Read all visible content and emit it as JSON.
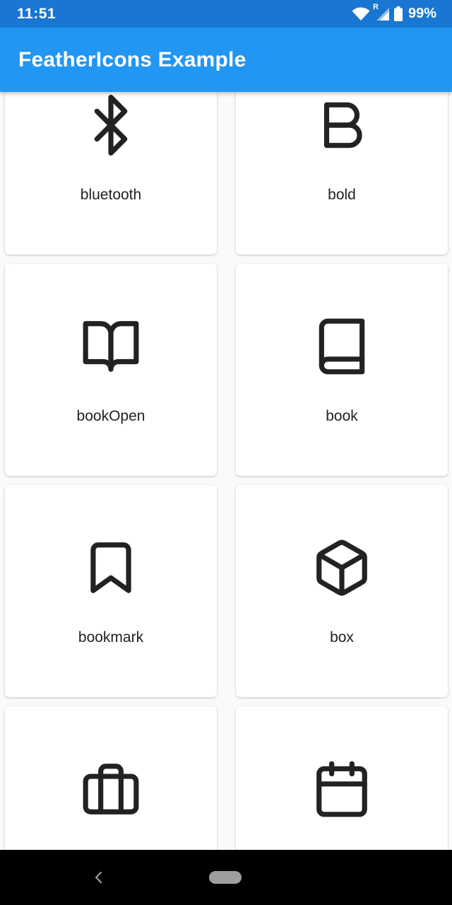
{
  "status_bar": {
    "time": "11:51",
    "network_badge": "R",
    "battery_percent": "99%",
    "icons": [
      "wifi-icon",
      "cell-signal-icon",
      "battery-icon"
    ]
  },
  "app_bar": {
    "title": "FeatherIcons Example",
    "color": "#2196f3",
    "status_color": "#1976d2"
  },
  "grid": {
    "items": [
      {
        "label": "bluetooth",
        "icon": "bluetooth-icon"
      },
      {
        "label": "bold",
        "icon": "bold-icon"
      },
      {
        "label": "bookOpen",
        "icon": "book-open-icon"
      },
      {
        "label": "book",
        "icon": "book-icon"
      },
      {
        "label": "bookmark",
        "icon": "bookmark-icon"
      },
      {
        "label": "box",
        "icon": "box-icon"
      },
      {
        "label": "",
        "icon": "briefcase-icon"
      },
      {
        "label": "",
        "icon": "calendar-icon"
      }
    ]
  },
  "nav_bar": {
    "icons": [
      "back-icon",
      "home-pill"
    ]
  }
}
